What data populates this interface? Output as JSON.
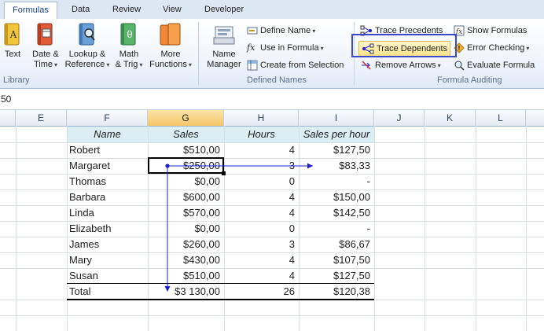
{
  "tabs": [
    "Formulas",
    "Data",
    "Review",
    "View",
    "Developer"
  ],
  "function_library": {
    "buttons": [
      {
        "line1": "Text",
        "line2": ""
      },
      {
        "line1": "Date &",
        "line2": "Time"
      },
      {
        "line1": "Lookup &",
        "line2": "Reference"
      },
      {
        "line1": "Math",
        "line2": "& Trig"
      },
      {
        "line1": "More",
        "line2": "Functions"
      }
    ],
    "label": "Library"
  },
  "defined_names": {
    "name_manager_line1": "Name",
    "name_manager_line2": "Manager",
    "define_name": "Define Name",
    "use_in_formula": "Use in Formula",
    "create_from_selection": "Create from Selection",
    "label": "Defined Names"
  },
  "formula_auditing": {
    "trace_precedents": "Trace Precedents",
    "trace_dependents": "Trace Dependents",
    "remove_arrows": "Remove Arrows",
    "show_formulas": "Show Formulas",
    "error_checking": "Error Checking",
    "evaluate_formula": "Evaluate Formula",
    "label": "Formula Auditing"
  },
  "formula_bar": {
    "value": "50"
  },
  "columns": [
    "E",
    "F",
    "G",
    "H",
    "I",
    "J",
    "K",
    "L"
  ],
  "table": {
    "headers": [
      "Name",
      "Sales",
      "Hours",
      "Sales per hour"
    ],
    "rows": [
      {
        "name": "Robert",
        "sales": "$510,00",
        "hours": "4",
        "sph": "$127,50"
      },
      {
        "name": "Margaret",
        "sales": "$250,00",
        "hours": "3",
        "sph": "$83,33"
      },
      {
        "name": "Thomas",
        "sales": "$0,00",
        "hours": "0",
        "sph": "-"
      },
      {
        "name": "Barbara",
        "sales": "$600,00",
        "hours": "4",
        "sph": "$150,00"
      },
      {
        "name": "Linda",
        "sales": "$570,00",
        "hours": "4",
        "sph": "$142,50"
      },
      {
        "name": "Elizabeth",
        "sales": "$0,00",
        "hours": "0",
        "sph": "-"
      },
      {
        "name": "James",
        "sales": "$260,00",
        "hours": "3",
        "sph": "$86,67"
      },
      {
        "name": "Mary",
        "sales": "$430,00",
        "hours": "4",
        "sph": "$107,50"
      },
      {
        "name": "Susan",
        "sales": "$510,00",
        "hours": "4",
        "sph": "$127,50"
      }
    ],
    "total": {
      "name": "Total",
      "sales": "$3 130,00",
      "hours": "26",
      "sph": "$120,38"
    }
  },
  "colors": {
    "header_band": "#dbeef4",
    "highlight_box": "#3b48c8",
    "trace_arrow": "#1f1fd0"
  }
}
